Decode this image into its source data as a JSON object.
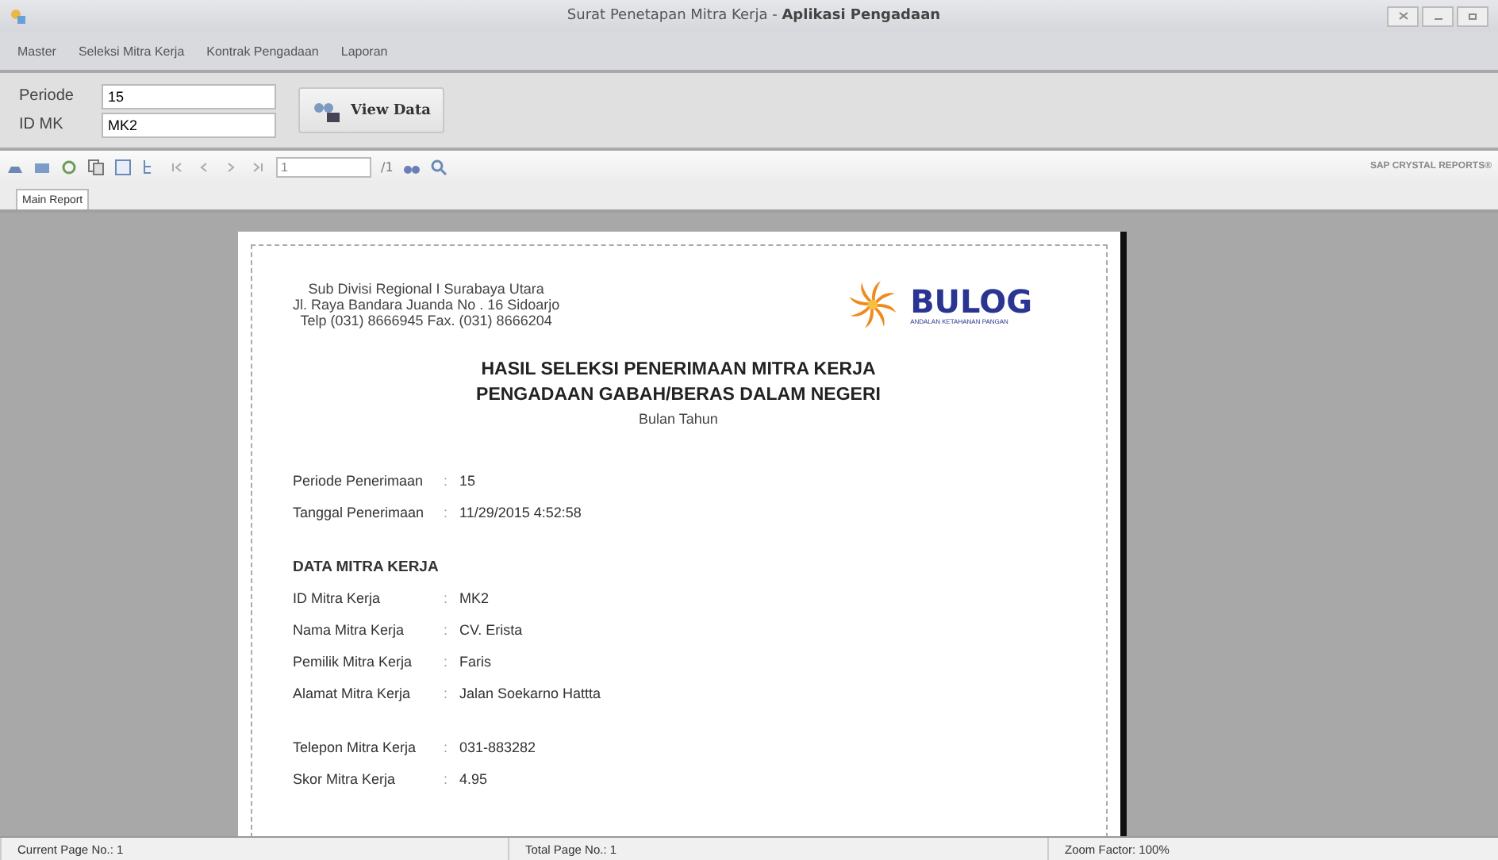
{
  "window": {
    "title_plain": "Surat Penetapan Mitra Kerja - ",
    "title_bold": "Aplikasi Pengadaan"
  },
  "menu": [
    "Master",
    "Seleksi Mitra Kerja",
    "Kontrak Pengadaan",
    "Laporan"
  ],
  "form": {
    "fields": [
      {
        "label": "Periode",
        "value": "15"
      },
      {
        "label": "ID MK",
        "value": "MK2"
      }
    ],
    "button": "View Data"
  },
  "toolbar": {
    "page_value": "1",
    "page_total": "/1",
    "brand": "SAP CRYSTAL REPORTS®"
  },
  "tabs": [
    {
      "label": "Main Report",
      "selected": true
    }
  ],
  "report": {
    "address": [
      "Sub Divisi Regional I Surabaya Utara",
      "Jl. Raya Bandara Juanda No . 16 Sidoarjo",
      "Telp (031) 8666945  Fax. (031) 8666204"
    ],
    "logo": {
      "name": "BULOG",
      "tagline": "ANDALAN KETAHANAN PANGAN"
    },
    "titles": [
      "HASIL SELEKSI PENERIMAAN MITRA KERJA",
      "PENGADAAN GABAH/BERAS DALAM NEGERI"
    ],
    "subtitle": "Bulan Tahun",
    "rows": [
      {
        "kind": "field",
        "label": "Periode  Penerimaan",
        "separator": ":",
        "value": "15"
      },
      {
        "kind": "field",
        "label": "Tanggal Penerimaan",
        "separator": ":",
        "value": "11/29/2015   4:52:58"
      },
      {
        "kind": "heading",
        "label": "DATA MITRA KERJA"
      },
      {
        "kind": "field",
        "label": "ID Mitra Kerja",
        "separator": ":",
        "value": "MK2"
      },
      {
        "kind": "field",
        "label": "Nama Mitra Kerja",
        "separator": ":",
        "value": "CV. Erista"
      },
      {
        "kind": "field",
        "label": "Pemilik Mitra Kerja",
        "separator": ":",
        "value": "Faris"
      },
      {
        "kind": "field",
        "label": "Alamat Mitra Kerja",
        "separator": ":",
        "value": "Jalan Soekarno Hattta"
      },
      {
        "kind": "field",
        "gap": true,
        "label": "Telepon Mitra Kerja",
        "separator": ":",
        "value": "031-883282"
      },
      {
        "kind": "field",
        "label": "Skor Mitra Kerja",
        "separator": ":",
        "value": "4.95"
      }
    ]
  },
  "status_bar": [
    "Current Page No.: 1",
    "Total Page No.: 1",
    "Zoom Factor: 100%"
  ]
}
